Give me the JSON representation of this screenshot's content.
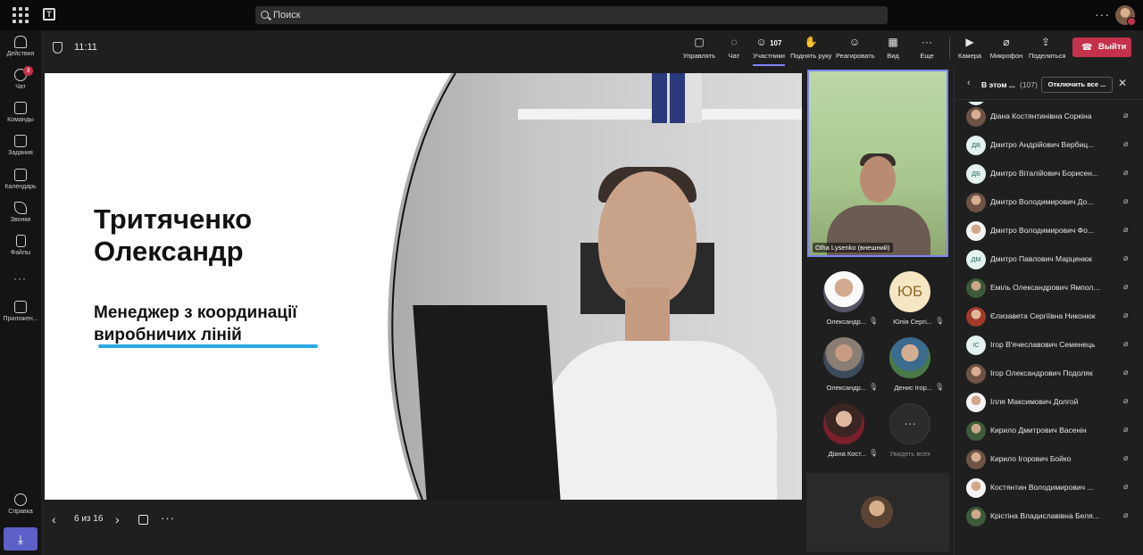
{
  "topbar": {
    "search_placeholder": "Поиск"
  },
  "rail": {
    "items": [
      {
        "label": "Действия",
        "icon": "bell-icon"
      },
      {
        "label": "Чат",
        "icon": "chat-icon",
        "badge": "3"
      },
      {
        "label": "Команды",
        "icon": "teams-icon"
      },
      {
        "label": "Задания",
        "icon": "assignments-icon"
      },
      {
        "label": "Календарь",
        "icon": "calendar-icon"
      },
      {
        "label": "Звонки",
        "icon": "phone-icon"
      },
      {
        "label": "Файлы",
        "icon": "file-icon"
      },
      {
        "label": "Приложен...",
        "icon": "apps-icon"
      },
      {
        "label": "Справка",
        "icon": "help-icon"
      }
    ]
  },
  "meeting": {
    "timer": "11:11",
    "controls": {
      "manage": "Управлять",
      "chat": "Чат",
      "participants": "Участники",
      "participants_count": "107",
      "raise_hand": "Поднять руку",
      "react": "Реагировать",
      "view": "Вид",
      "more": "Еще",
      "camera": "Камера",
      "mic": "Микрофон",
      "share": "Поделиться",
      "leave": "Выйти"
    }
  },
  "slide": {
    "name_line1": "Тритяченко",
    "name_line2": "Олександр",
    "role_line1": "Менеджер з координації",
    "role_line2": "виробничих ліній",
    "accent_color": "#27a9e1"
  },
  "pager": {
    "text": "6 из 16"
  },
  "speaker": {
    "name": "Olha Lysenko (внешний)"
  },
  "gallery": {
    "tiles": [
      {
        "name": "Олександр..."
      },
      {
        "name": "Юлія Сергі...",
        "initials": "ЮБ"
      },
      {
        "name": "Олександр..."
      },
      {
        "name": "Денис Ігор..."
      },
      {
        "name": "Діана Кост..."
      }
    ],
    "view_all": "Увидеть всех"
  },
  "panel": {
    "title": "В этом ...",
    "count": "(107)",
    "mute_all": "Отключить все ...",
    "participants": [
      {
        "name": "Діана Костянтинівна Соркіна"
      },
      {
        "name": "Дмитро Андрійович Вербиц...",
        "initials": "ДВ"
      },
      {
        "name": "Дмитро Віталійович Борисен...",
        "initials": "ДБ"
      },
      {
        "name": "Дмитро Володимирович До..."
      },
      {
        "name": "Дмитро Володимирович Фо..."
      },
      {
        "name": "Дмитро Павлович Марценюк",
        "initials": "ДМ"
      },
      {
        "name": "Еміль Олександрович Ямпол..."
      },
      {
        "name": "Єлизавета Сергіївна Никонюк"
      },
      {
        "name": "Ігор В'ячеславович Семенець",
        "initials": "ІС"
      },
      {
        "name": "Ігор Олександрович Подоляк"
      },
      {
        "name": "Ілля Максимович Долгой"
      },
      {
        "name": "Кирило Дмитрович Васенін"
      },
      {
        "name": "Кирило Ігорович Бойко"
      },
      {
        "name": "Костянтин Володимирович ..."
      },
      {
        "name": "Крістіна Владиславівна Беля..."
      }
    ]
  }
}
